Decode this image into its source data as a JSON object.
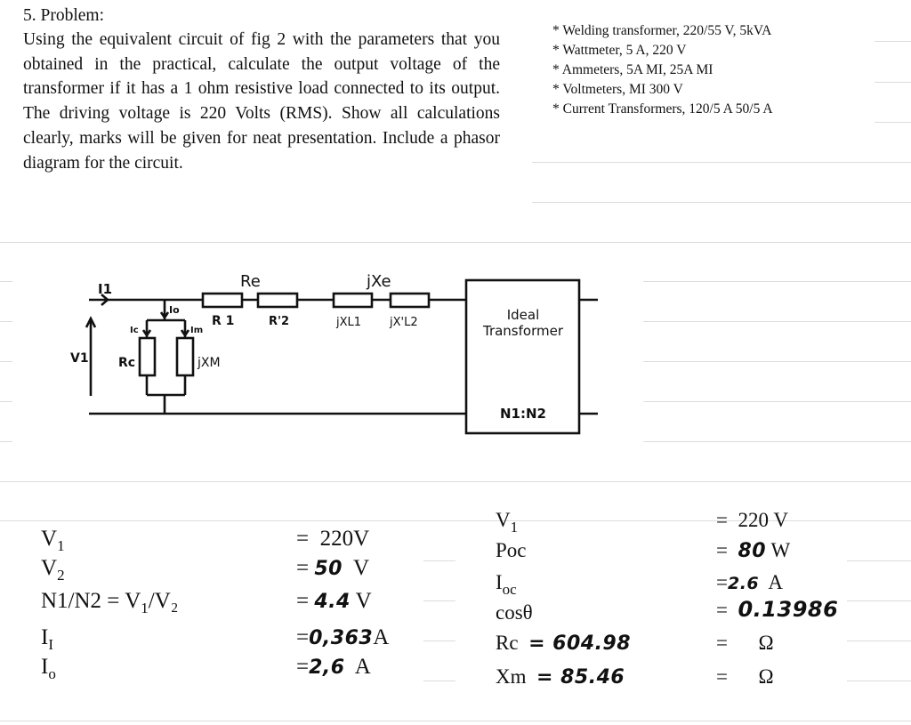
{
  "problem": {
    "title": "5. Problem:",
    "body": "Using the equivalent circuit of fig 2 with the parameters that you obtained in the practical, calculate the output voltage of the transformer if it has a 1 ohm resistive load connected to its output. The driving voltage is 220 Volts (RMS). Show all calculations clearly, marks will be given for neat presentation. Include a phasor diagram for the circuit."
  },
  "equipment": [
    "* Welding transformer, 220/55 V, 5kVA",
    "* Wattmeter, 5 A, 220 V",
    "* Ammeters, 5A MI, 25A MI",
    "* Voltmeters, MI 300 V",
    "* Current Transformers, 120/5 A 50/5 A"
  ],
  "circuit": {
    "labels": {
      "i1": "I1",
      "v1": "V1",
      "io": "Io",
      "ic": "Ic",
      "im": "Im",
      "rc": "Rc",
      "jxm": "jXM",
      "re": "Re",
      "jxe": "jXe",
      "r1": "R 1",
      "r2": "R'2",
      "jxl1": "jXL1",
      "jxl2": "jX'L2",
      "ideal_line1": "Ideal",
      "ideal_line2": "Transformer",
      "ratio": "N1:N2"
    }
  },
  "left_equations": [
    {
      "lhs": "V",
      "lhs_sub": "1",
      "lhs_extra": "",
      "eq": "=",
      "value": "220V",
      "handwritten": "",
      "unit": ""
    },
    {
      "lhs": "V",
      "lhs_sub": "2",
      "lhs_extra": "",
      "eq": "=",
      "value": "",
      "handwritten": "50",
      "unit": "V"
    },
    {
      "lhs": "N1/N2 = V",
      "lhs_sub": "1",
      "lhs_extra": "/V₂",
      "eq": "=",
      "value": "",
      "handwritten": "4.4",
      "unit": "V"
    },
    {
      "lhs": "I",
      "lhs_sub": "I",
      "lhs_extra": "",
      "eq": "=",
      "value": "",
      "handwritten": "0,363",
      "unit": "A"
    },
    {
      "lhs": "I",
      "lhs_sub": "o",
      "lhs_extra": "",
      "eq": "=",
      "value": "",
      "handwritten": "2,6",
      "unit": "A"
    }
  ],
  "right_equations": [
    {
      "lhs": "V",
      "lhs_sub": "1",
      "inline_hw": "",
      "eq": "=",
      "value": "220 V",
      "handwritten": "",
      "unit": ""
    },
    {
      "lhs": "Poc",
      "lhs_sub": "",
      "inline_hw": "",
      "eq": "=",
      "value": "",
      "handwritten": "80",
      "unit": "W"
    },
    {
      "lhs": "I",
      "lhs_sub": "oc",
      "inline_hw": "",
      "eq": "=",
      "value": "",
      "handwritten": "2.6",
      "unit": "A"
    },
    {
      "lhs": "cosθ",
      "lhs_sub": "",
      "inline_hw": "",
      "eq": "=",
      "value": "",
      "handwritten": "0.13986",
      "unit": ""
    },
    {
      "lhs": "Rc",
      "lhs_sub": "",
      "inline_hw": "= 604.98",
      "eq": "=",
      "value": "",
      "handwritten": "",
      "unit": "Ω"
    },
    {
      "lhs": "Xm",
      "lhs_sub": "",
      "inline_hw": "= 85.46",
      "eq": "=",
      "value": "",
      "handwritten": "",
      "unit": "Ω"
    }
  ]
}
